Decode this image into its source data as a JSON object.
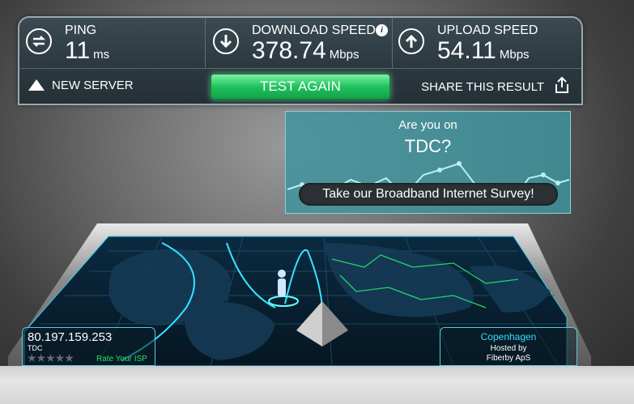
{
  "results": {
    "ping": {
      "label": "PING",
      "value": "11",
      "unit": "ms"
    },
    "download": {
      "label": "DOWNLOAD SPEED",
      "value": "378.74",
      "unit": "Mbps"
    },
    "upload": {
      "label": "UPLOAD SPEED",
      "value": "54.11",
      "unit": "Mbps"
    }
  },
  "actions": {
    "new_server": "NEW SERVER",
    "test_again": "TEST AGAIN",
    "share": "SHARE THIS RESULT"
  },
  "survey": {
    "prompt": "Are you on",
    "isp": "TDC?",
    "button": "Take our Broadband Internet Survey!"
  },
  "client": {
    "ip": "80.197.159.253",
    "isp": "TDC",
    "stars": "★★★★★",
    "rate": "Rate Your ISP"
  },
  "server": {
    "city": "Copenhagen",
    "hosted_by_label": "Hosted by",
    "host": "Fiberby ApS"
  },
  "colors": {
    "accent_green": "#1fc25e",
    "map_glow": "#30e0ff",
    "survey_bg": "#3e949e"
  }
}
